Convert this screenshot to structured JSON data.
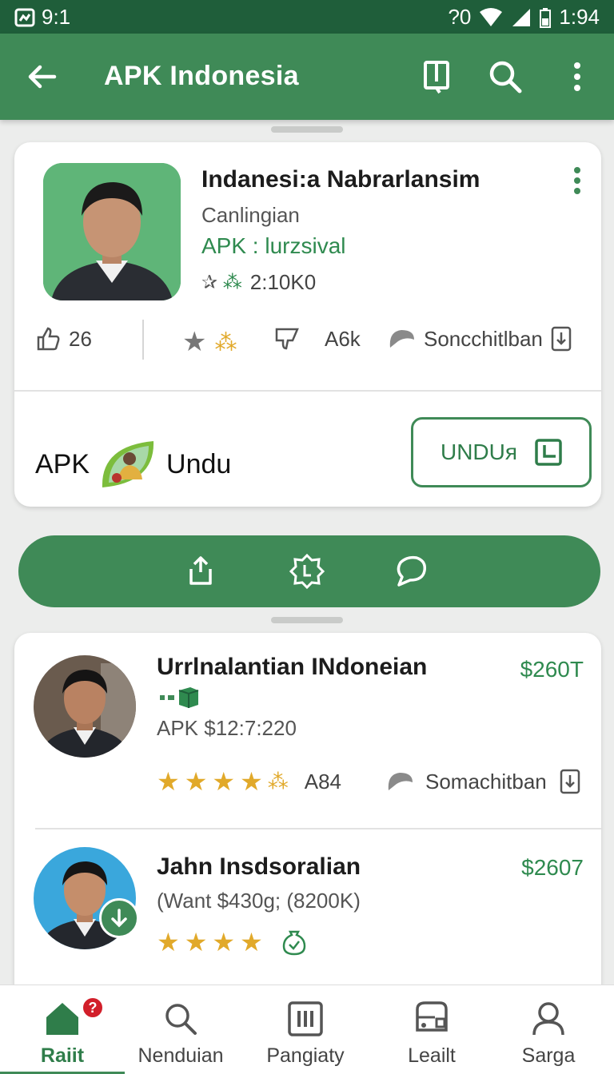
{
  "status_bar": {
    "time_left": "9:1",
    "time_right": "1:94",
    "carrier": "?0"
  },
  "app_bar": {
    "title": "APK Indonesia"
  },
  "featured": {
    "name": "Indanesi:a Nabrarlansim",
    "developer": "Canlingian",
    "apk_line": "APK : lurzsival",
    "rating_text": "2:10K0",
    "stats": {
      "likes": "26",
      "reviews": "A6k",
      "category": "Soncchitlban"
    },
    "download_label_left": "APK",
    "download_label_right": "Undu",
    "download_button": "UNDUя"
  },
  "list": [
    {
      "title": "Urrlnalantian INdoneian",
      "subtitle": "APK $12:7:220",
      "price": "$260T",
      "rating_count": "A84",
      "category": "Somachitban",
      "stars": 4.5
    },
    {
      "title": "Jahn Insdsoralian",
      "subtitle": "(Want $430g; (8200K)",
      "price": "$2607",
      "stars": 4
    }
  ],
  "bottom_nav": [
    {
      "label": "Raiit",
      "icon": "home-icon",
      "badge": "?"
    },
    {
      "label": "Nenduian",
      "icon": "search-icon"
    },
    {
      "label": "Pangiaty",
      "icon": "library-icon"
    },
    {
      "label": "Leailt",
      "icon": "bus-icon"
    },
    {
      "label": "Sarga",
      "icon": "person-icon"
    }
  ],
  "colors": {
    "primary": "#3f8a57",
    "dark": "#1f5e3a",
    "star": "#e1a92a",
    "price": "#2f8a4f"
  }
}
